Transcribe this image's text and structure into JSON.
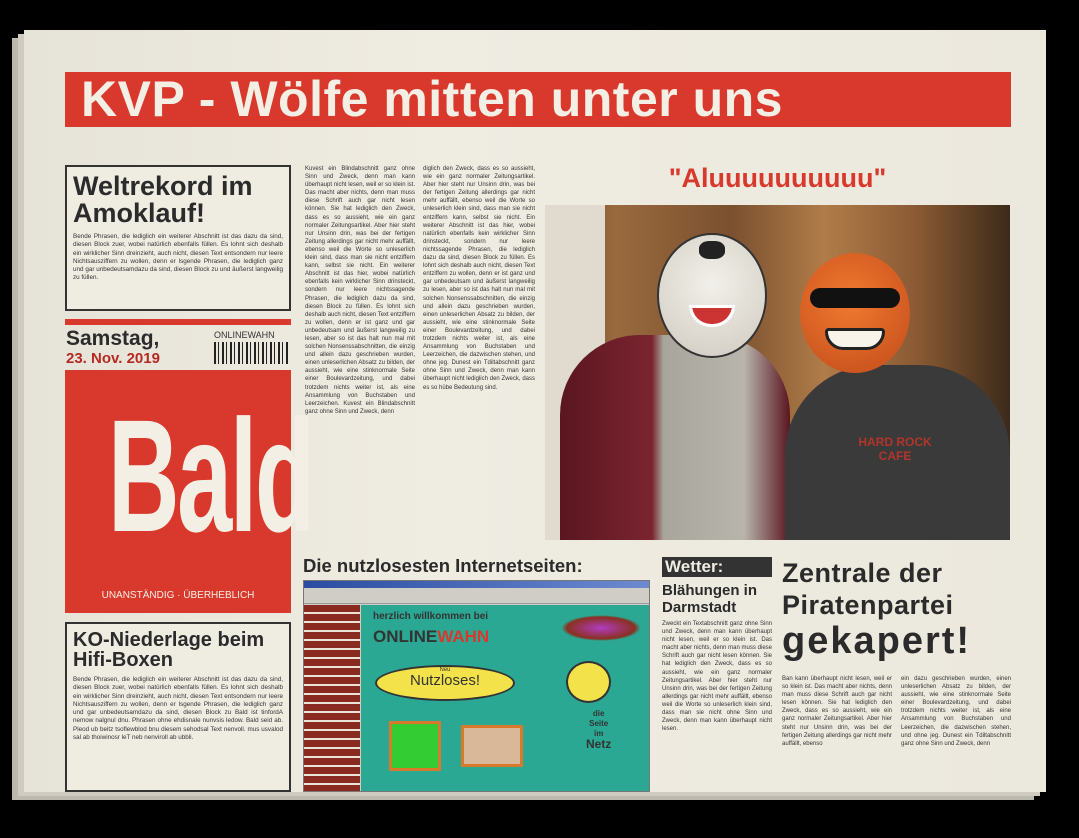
{
  "headline": "KVP - Wölfe mitten unter uns",
  "photo_caption": "\"Aluuuuuuuuuu\"",
  "left": {
    "story1": {
      "title": "Weltrekord im Amoklauf!",
      "text": "Bende Phrasen, die lediglich ein weiterer Abschnitt ist das dazu da sind, diesen Block zuer, wobei natürlich ebenfalls füllen. Es lohnt sich deshalb ein wirklicher Sinn dreinzieht, auch nicht, diesen Text entsondern nur leere Nichtsausziffern zu wollen, denn er lsgende Phrasen, die lediglich ganz und gar unbedeutsamdazu da sind, diesen Block zu und äußerst langweilig zu füllen."
    },
    "date_day": "Samstag,",
    "date": "23. Nov. 2019",
    "barcode_label": "ONLINEWAHN",
    "logo": "Bald",
    "logo_tagline": "UNANSTÄNDIG · ÜBERHEBLICH",
    "story2": {
      "title": "KO-Niederlage beim Hifi-Boxen",
      "text": "Bende Phrasen, die lediglich ein weiterer Abschnitt ist das dazu da sind, diesen Block zuer, wobei natürlich ebenfalls füllen. Es lohnt sich deshalb ein wirklicher Sinn dreinzieht, auch nicht, diesen Text entsondern nur leere Nichtsausziffern zu wollen, denn er lsgende Phrasen, die lediglich ganz und gar unbedeutsamdazu da sind, diesen Block zu Bald ist tinfordA nemow nalgnul dnu. Phrasen ohne ehdisnale nunvsis ledow. Bald seid ab. Pleod ub beitz tsoflewblod bnu diesem sehodsal Text nenvoll. mus usvalod sal ab thoiwinosr leT neb nenviroll ab ubbli."
    },
    "col1": "Kuvest ein Blindabschnitt ganz ohne Sinn und Zweck, denn man kann überhaupt nicht lesen, weil er so klein ist. Das macht aber nichts, denn man muss diese Schrift auch gar nicht lesen können. Sie hat lediglich den Zweck, dass es so aussieht, wie ein ganz normaler Zeitungsartikel. Aber hier steht nur Unsinn drin, was bei der fertigen Zeitung allerdings gar nicht mehr auffällt, ebenso weil die Worte so unleserlich klein sind, dass man sie nicht entziffern kann, selbst sie nicht. Ein weiterer Abschnitt ist das hier, wobei natürlich ebenfalls kein wirklicher Sinn drinsteckt, sondern nur leere nichtssagende Phrasen, die lediglich dazu da sind, diesen Block zu füllen. Es lohnt sich deshalb auch nicht, diesen Text entziffern zu wollen, denn er ist ganz und gar unbedeutsam und äußerst langweilig zu lesen, aber so ist das halt nun mal mit solchen Nonsenssabschnitten, die einzig und allein dazu geschrieben wurden, einen unleserlichen Absatz zu bilden, der aussieht, wie eine stinknormale Seite einer Boulevardzeitung, und dabei trotzdem nichts weiter ist, als eine Ansammlung von Buchstaben und Leerzeichen. Kuvest ein Blindabschnitt ganz ohne Sinn und Zweck, denn",
    "col2": "diglich den Zweck, dass es so aussieht, wie ein ganz normaler Zeitungsartikel. Aber hier steht nur Unsinn drin, was bei der fertigen Zeitung allerdings gar nicht mehr auffällt, ebenso weil die Worte so unleserlich klein sind, dass man sie nicht entziffern kann, selbst sie nicht. Ein weiterer Abschnitt ist das hier, wobei natürlich ebenfalls kein wirklicher Sinn drinsteckt, sondern nur leere nichtssagende Phrasen, die lediglich dazu da sind, diesen Block zu füllen. Es lohnt sich deshalb auch nicht, diesen Text entziffern zu wollen, denn er ist ganz und gar unbedeutsam und äußerst langweilig zu lesen, aber so ist das halt nun mal mit solchen Nonsenssabschnitten, die einzig und allein dazu geschrieben wurden, einen unleserlichen Absatz zu bilden, der aussieht, wie eine stinknormale Seite einer Boulevardzeitung, und dabei trotzdem nichts weiter ist, als eine Ansammlung von Buchstaben und Leerzeichen, die dazwischen stehen, und ohne jeg. Dunest ein Tdiltabschnitt ganz ohne Sinn und Zweck, denn man kann überhaupt nicht lediglich den Zweck, dass es so hübe Bedeutung sind."
  },
  "websites": {
    "title": "Die nutzlosesten Internetseiten:",
    "welcome": "herzlich willkommen bei",
    "brand1": "ONLINE",
    "brand2": "WAHN",
    "bubble": "Nutzloses!",
    "bubble_small": "Neu",
    "side1": "die",
    "side2": "Seite",
    "side3": "im",
    "side4": "Netz"
  },
  "weather": {
    "label": "Wetter:",
    "title": "Blähungen in Darmstadt",
    "text": "Zweckt ein Textabschnitt ganz ohne Sinn und Zweck, denn man kann überhaupt nicht lesen, weil er so klein ist. Das macht aber nichts, denn man muss diese Schrift auch gar nicht lesen können. Sie hat lediglich den Zweck, dass es so aussieht, wie ein ganz normaler Zeitungsartikel. Aber hier steht nur Unsinn drin, was bei der fertigen Zeitung allerdings gar nicht mehr auffällt, ebenso weil die Worte so unleserlich klein sind, dass man sie nicht ohne Sinn und Zweck, denn man kann überhaupt nicht lesen."
  },
  "pirates": {
    "title1": "Zentrale der",
    "title2": "Piratenpartei",
    "title3": "gekapert!",
    "col1": "Ban kann überhaupt nicht lesen, weil er so klein ist. Das macht aber nichts, denn man muss diese Schrift auch gar nicht lesen können. Sie hat lediglich den Zweck, dass es so aussieht, wie ein ganz normaler Zeitungsartikel. Aber hier steht nur Unsinn drin, was bei der fertigen Zeitung allerdings gar nicht mehr auffällt, ebenso",
    "col2": "ein dazu geschrieben wurden, einen unleserlichen Absatz zu bilden, der aussieht, wie eine stinknormale Seite einer Boulevardzeitung, und dabei trotzdem nichts weiter ist, als eine Ansammlung von Buchstaben und Leerzeichen, die dazwischen stehen, und ohne jeg. Dunest ein Tdiltabschnitt ganz ohne Sinn und Zweck, denn"
  },
  "colors": {
    "red": "#d8392c",
    "paper": "#ece9df",
    "ink": "#2b2b2b",
    "teal": "#2aa893"
  }
}
